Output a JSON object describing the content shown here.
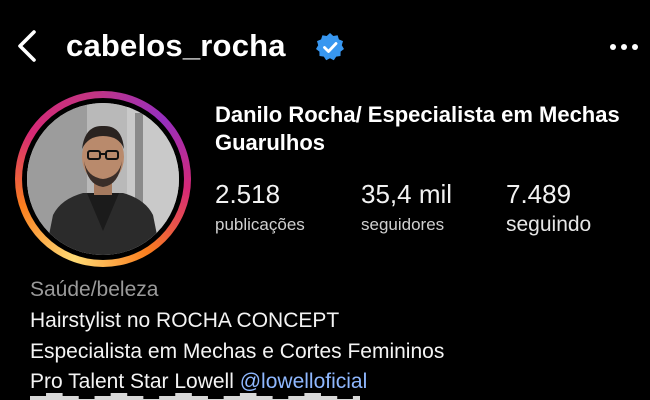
{
  "header": {
    "username": "cabelos_rocha",
    "back_icon": "chevron-left-icon",
    "verified_icon": "verified-badge-icon",
    "more_icon": "more-horizontal-icon"
  },
  "profile": {
    "full_name": "Danilo Rocha/ Especialista em Mechas Guarulhos",
    "avatar_icon": "profile-photo"
  },
  "stats": [
    {
      "value": "2.518",
      "label": "publicações"
    },
    {
      "value": "35,4 mil",
      "label": "seguidores"
    },
    {
      "value": "7.489",
      "label": "seguindo"
    }
  ],
  "bio": {
    "category": "Saúde/beleza",
    "line1": "Hairstylist no ROCHA CONCEPT",
    "line2": "Especialista em Mechas e Cortes Femininos",
    "line3_text": "Pro Talent Star Lowell",
    "line3_mention": "@lowelloficial"
  },
  "colors": {
    "background": "#000000",
    "text": "#ffffff",
    "muted": "#9a9a9a",
    "link": "#8fb8ff",
    "verified": "#3897f0",
    "story_ring": [
      "#feda75",
      "#fa7e1e",
      "#d62976",
      "#962fbf"
    ]
  }
}
